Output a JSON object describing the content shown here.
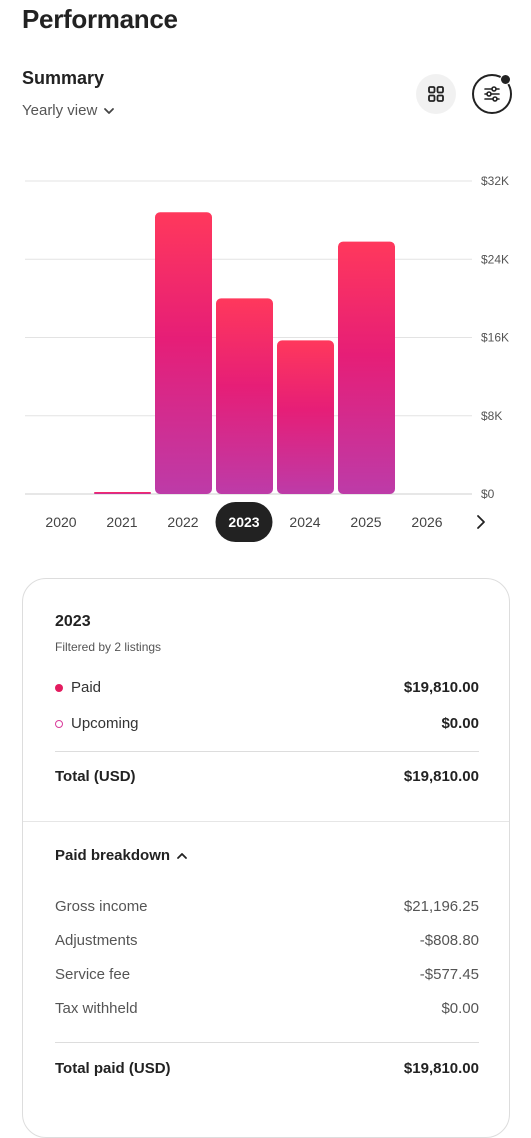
{
  "page": {
    "title": "Performance"
  },
  "summary": {
    "title": "Summary",
    "view_label": "Yearly view"
  },
  "icons": {
    "grid": "grid-icon",
    "filter": "filter-sliders-icon",
    "chevron": "chevron-down-icon",
    "next": "chevron-right-icon"
  },
  "colors": {
    "bar_top": "#FF385C",
    "bar_mid": "#E61E77",
    "bar_bottom": "#BD3BA8",
    "paid_dot": "#E31C5F",
    "upcoming_dot": "#D93B9A"
  },
  "chart_data": {
    "type": "bar",
    "categories": [
      "2020",
      "2021",
      "2022",
      "2023",
      "2024",
      "2025",
      "2026"
    ],
    "values": [
      0,
      200,
      28800,
      20000,
      15700,
      25800,
      0
    ],
    "ylim": [
      0,
      32000
    ],
    "y_ticks": [
      0,
      8000,
      16000,
      24000,
      32000
    ],
    "y_tick_labels": [
      "$0",
      "$8K",
      "$16K",
      "$24K",
      "$32K"
    ],
    "selected": "2023",
    "y_axis_position": "right",
    "grid": true
  },
  "years": {
    "items": [
      "2020",
      "2021",
      "2022",
      "2023",
      "2024",
      "2025",
      "2026"
    ],
    "selected_index": 3
  },
  "card": {
    "year": "2023",
    "filter_note": "Filtered by 2 listings",
    "paid_label": "Paid",
    "paid_value": "$19,810.00",
    "upcoming_label": "Upcoming",
    "upcoming_value": "$0.00",
    "total_label": "Total (USD)",
    "total_value": "$19,810.00",
    "breakdown_label": "Paid breakdown",
    "breakdown": [
      {
        "label": "Gross income",
        "value": "$21,196.25"
      },
      {
        "label": "Adjustments",
        "value": "-$808.80"
      },
      {
        "label": "Service fee",
        "value": "-$577.45"
      },
      {
        "label": "Tax withheld",
        "value": "$0.00"
      }
    ],
    "total_paid_label": "Total paid (USD)",
    "total_paid_value": "$19,810.00"
  }
}
